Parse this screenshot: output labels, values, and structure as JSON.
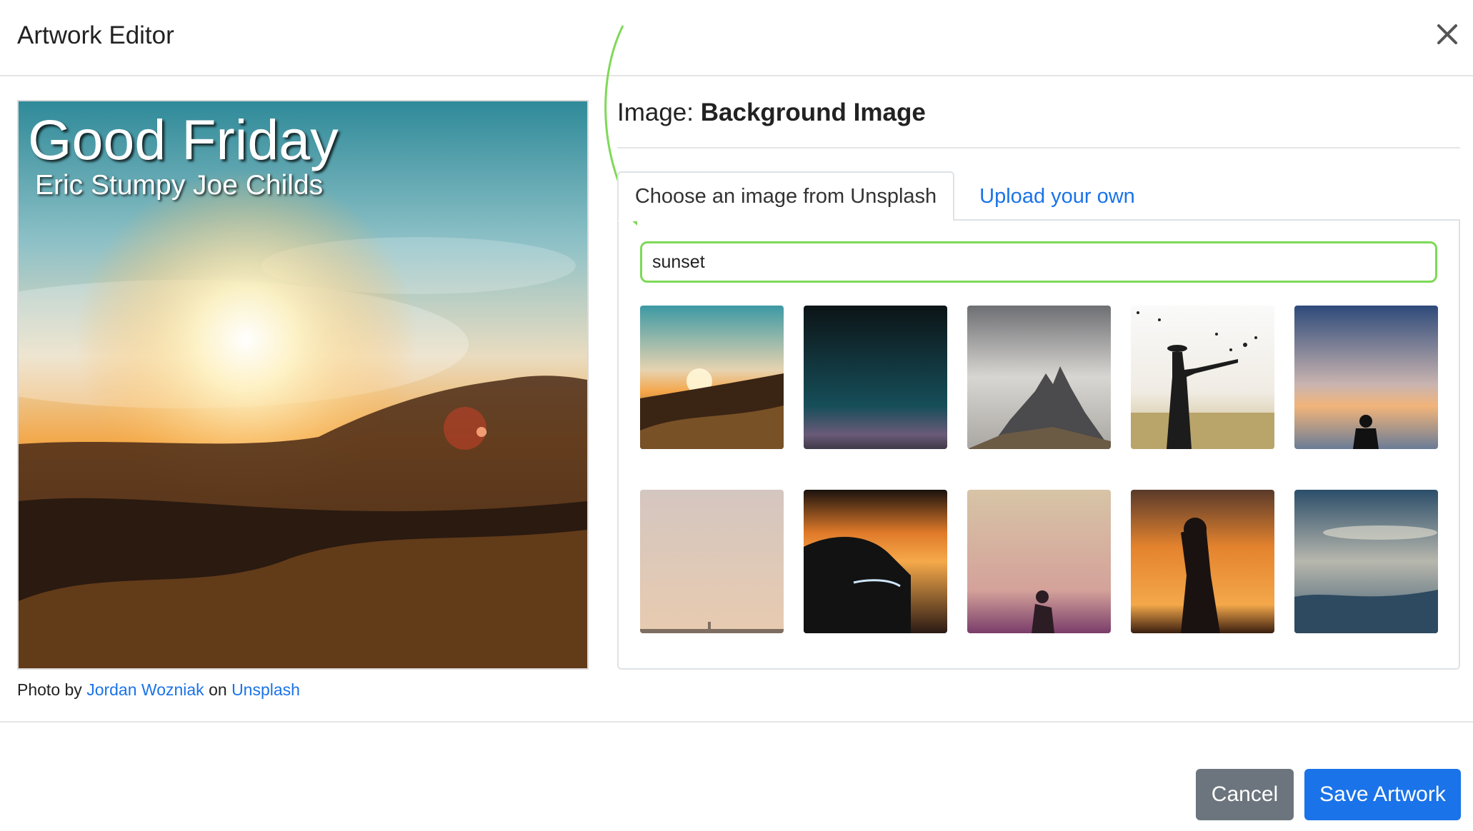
{
  "modal": {
    "title": "Artwork Editor"
  },
  "artwork": {
    "title": "Good Friday",
    "subtitle": "Eric Stumpy Joe Childs",
    "credit": {
      "prefix": "Photo by",
      "author": "Jordan Wozniak",
      "middle": "on",
      "source": "Unsplash"
    }
  },
  "image_section": {
    "label": "Image:",
    "name": "Background Image"
  },
  "tabs": [
    {
      "label": "Choose an image from Unsplash",
      "active": true
    },
    {
      "label": "Upload your own",
      "active": false
    }
  ],
  "search": {
    "value": "sunset",
    "placeholder": ""
  },
  "results": [
    {
      "id": "sunset-hills"
    },
    {
      "id": "dark-teal-dusk"
    },
    {
      "id": "rocky-peaks"
    },
    {
      "id": "woman-with-birds"
    },
    {
      "id": "person-at-water"
    },
    {
      "id": "pale-sky-city"
    },
    {
      "id": "car-at-sunset"
    },
    {
      "id": "silhouette-pink-sky"
    },
    {
      "id": "woman-orange-sky"
    },
    {
      "id": "blue-mountain-clouds"
    }
  ],
  "footer": {
    "cancel_label": "Cancel",
    "save_label": "Save Artwork"
  },
  "colors": {
    "accent": "#1a73e8",
    "cancel": "#6c757d",
    "highlight": "#7ed957"
  }
}
